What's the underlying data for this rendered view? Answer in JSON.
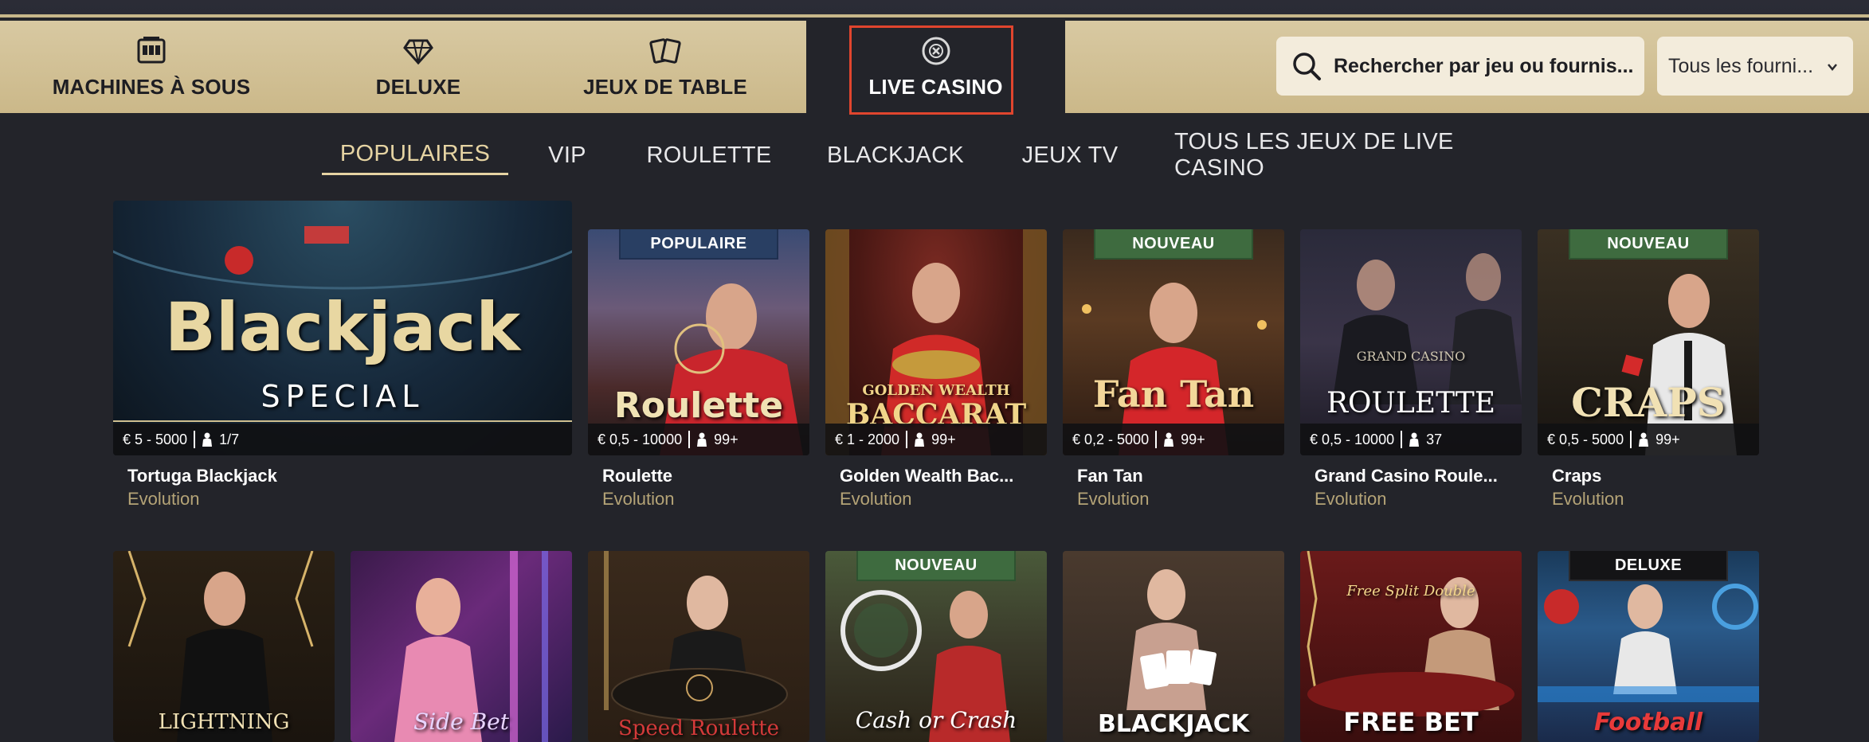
{
  "categories": [
    {
      "label": "MACHINES À SOUS",
      "icon": "slot-machine-icon"
    },
    {
      "label": "DELUXE",
      "icon": "diamond-icon"
    },
    {
      "label": "JEUX DE TABLE",
      "icon": "cards-icon"
    },
    {
      "label": "LIVE CASINO",
      "icon": "roulette-chip-icon",
      "active": true
    }
  ],
  "search": {
    "placeholder": "Rechercher par jeu ou fournis..."
  },
  "provider": {
    "selected": "Tous les fourni..."
  },
  "subnav": [
    {
      "label": "POPULAIRES",
      "active": true
    },
    {
      "label": "VIP"
    },
    {
      "label": "ROULETTE"
    },
    {
      "label": "BLACKJACK"
    },
    {
      "label": "JEUX TV"
    },
    {
      "label": "TOUS LES JEUX DE LIVE CASINO"
    }
  ],
  "games_row1": [
    {
      "name": "Tortuga Blackjack",
      "provider": "Evolution",
      "limits": "€ 5 - 5000",
      "players": "1/7",
      "badge": "",
      "thumb_title": "Blackjack",
      "thumb_sub": "SPECIAL"
    },
    {
      "name": "Roulette",
      "provider": "Evolution",
      "limits": "€ 0,5 - 10000",
      "players": "99+",
      "badge": "POPULAIRE",
      "thumb_title": "Roulette",
      "thumb_sub": ""
    },
    {
      "name": "Golden Wealth Bac...",
      "provider": "Evolution",
      "limits": "€ 1 - 2000",
      "players": "99+",
      "badge": "",
      "thumb_title": "BACCARAT",
      "thumb_sub": "GOLDEN WEALTH"
    },
    {
      "name": "Fan Tan",
      "provider": "Evolution",
      "limits": "€ 0,2 - 5000",
      "players": "99+",
      "badge": "NOUVEAU",
      "thumb_title": "Fan Tan",
      "thumb_sub": ""
    },
    {
      "name": "Grand Casino Roule...",
      "provider": "Evolution",
      "limits": "€ 0,5 - 10000",
      "players": "37",
      "badge": "",
      "thumb_title": "ROULETTE",
      "thumb_sub": "GRAND CASINO"
    },
    {
      "name": "Craps",
      "provider": "Evolution",
      "limits": "€ 0,5 - 5000",
      "players": "99+",
      "badge": "NOUVEAU",
      "thumb_title": "CRAPS",
      "thumb_sub": ""
    }
  ],
  "games_row2": [
    {
      "badge": "",
      "thumb_title": "LIGHTNING"
    },
    {
      "badge": "",
      "thumb_title": "Side Bet"
    },
    {
      "badge": "",
      "thumb_title": "Speed Roulette"
    },
    {
      "badge": "NOUVEAU",
      "thumb_title": "Cash or Crash"
    },
    {
      "badge": "",
      "thumb_title": "BLACKJACK"
    },
    {
      "badge": "",
      "thumb_title": "FREE BET",
      "thumb_sub": "Free Split Double"
    },
    {
      "badge": "DELUXE",
      "thumb_title": "Football"
    }
  ]
}
